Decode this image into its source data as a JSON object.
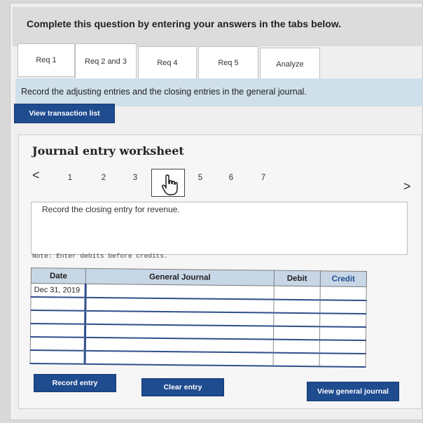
{
  "header": {
    "instruction": "Complete this question by entering your answers in the tabs below."
  },
  "tabs": [
    {
      "label": "Req 1"
    },
    {
      "label": "Req 2 and 3"
    },
    {
      "label": "Req 4"
    },
    {
      "label": "Req 5"
    },
    {
      "label": "Analyze"
    }
  ],
  "requirement": {
    "text": "Record the adjusting entries and the closing entries in the general journal."
  },
  "buttons": {
    "view_transaction_list": "View transaction list",
    "record_entry": "Record entry",
    "clear_entry": "Clear entry",
    "view_general_journal": "View general journal"
  },
  "worksheet": {
    "title": "Journal entry worksheet",
    "pages": [
      "1",
      "2",
      "3",
      "4",
      "5",
      "6",
      "7"
    ],
    "current_page": "4",
    "prev_arrow": "<",
    "next_arrow": ">",
    "prompt": "Record the closing entry for revenue.",
    "note": "Note: Enter debits before credits."
  },
  "journal_table": {
    "headers": {
      "date": "Date",
      "general_journal": "General Journal",
      "debit": "Debit",
      "credit": "Credit"
    },
    "rows": [
      {
        "date": "Dec 31, 2019",
        "account": "",
        "debit": "",
        "credit": ""
      },
      {
        "date": "",
        "account": "",
        "debit": "",
        "credit": ""
      },
      {
        "date": "",
        "account": "",
        "debit": "",
        "credit": ""
      },
      {
        "date": "",
        "account": "",
        "debit": "",
        "credit": ""
      },
      {
        "date": "",
        "account": "",
        "debit": "",
        "credit": ""
      },
      {
        "date": "",
        "account": "",
        "debit": "",
        "credit": ""
      }
    ]
  },
  "colors": {
    "button_blue": "#1f4b8f",
    "requirement_bar": "#cfe0ea",
    "table_header": "#c8d7e6"
  },
  "icons": {
    "cursor": "hand-pointer-icon"
  }
}
